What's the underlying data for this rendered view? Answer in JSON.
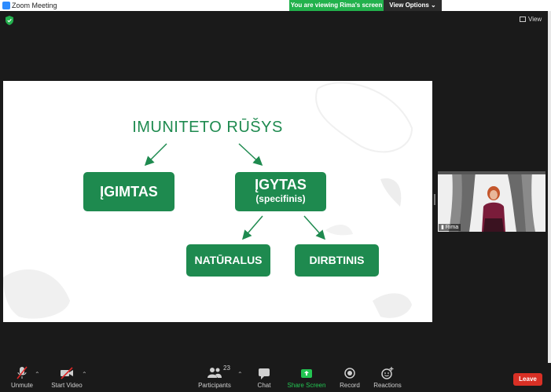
{
  "window": {
    "title": "Zoom Meeting"
  },
  "banner": {
    "viewing": "You are viewing Rima's screen",
    "view_options": "View Options ⌄"
  },
  "top_right": {
    "view_label": "View"
  },
  "slide": {
    "title": "IMUNITETO RŪŠYS",
    "box_innate": "ĮGIMTAS",
    "box_acquired": "ĮGYTAS",
    "box_acquired_sub": "(specifinis)",
    "box_natural": "NATŪRALUS",
    "box_artificial": "DIRBTINIS",
    "accent_color": "#1e8a4f"
  },
  "participant": {
    "name": "Rima"
  },
  "toolbar": {
    "unmute": "Unmute",
    "start_video": "Start Video",
    "participants": "Participants",
    "participants_count": "23",
    "chat": "Chat",
    "share_screen": "Share Screen",
    "record": "Record",
    "reactions": "Reactions",
    "leave": "Leave"
  }
}
